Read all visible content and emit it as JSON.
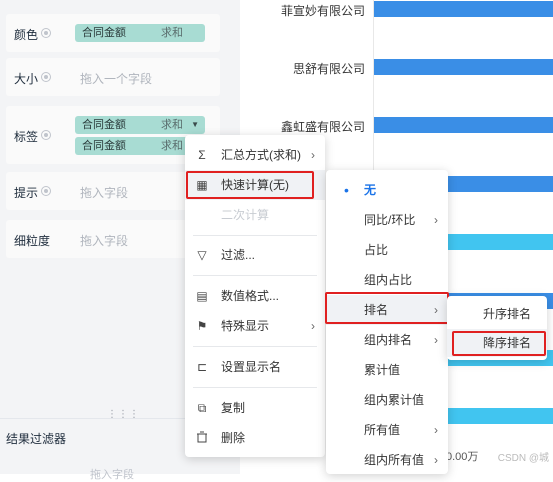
{
  "fields": {
    "color": {
      "label": "颜色",
      "pill_name": "合同金额",
      "pill_agg": "求和"
    },
    "size": {
      "label": "大小",
      "placeholder": "拖入一个字段"
    },
    "tag": {
      "label": "标签",
      "pill1_name": "合同金额",
      "pill1_agg": "求和",
      "pill2_name": "合同金额",
      "pill2_agg": "求和"
    },
    "tooltip": {
      "label": "提示",
      "placeholder": "拖入字段"
    },
    "granularity": {
      "label": "细粒度",
      "placeholder": "拖入字段"
    }
  },
  "result_filter": {
    "title": "结果过滤器",
    "placeholder": "拖入字段"
  },
  "chart": {
    "categories": [
      "菲宣妙有限公司",
      "思舒有限公司",
      "鑫虹盛有限公司"
    ],
    "x_tick": "0.00万",
    "watermark": "CSDN @城"
  },
  "context_menu": {
    "items": [
      {
        "label": "汇总方式(求和)",
        "icon": "sigma-icon",
        "glyph": "Σ"
      },
      {
        "label": "快速计算(无)",
        "icon": "calculator-icon",
        "glyph": "▦"
      },
      {
        "label": "二次计算"
      },
      {
        "label": "过滤...",
        "icon": "filter-icon",
        "glyph": "▽"
      },
      {
        "label": "数值格式...",
        "icon": "number-format-icon",
        "glyph": "▤"
      },
      {
        "label": "特殊显示",
        "icon": "flag-icon",
        "glyph": "⚑"
      },
      {
        "label": "设置显示名",
        "icon": "rename-icon",
        "glyph": "⊏"
      },
      {
        "label": "复制",
        "icon": "copy-icon",
        "glyph": "⧉"
      },
      {
        "label": "删除",
        "icon": "trash-icon",
        "glyph": "🗑"
      }
    ]
  },
  "quick_calc_menu": {
    "items": [
      "无",
      "同比/环比",
      "占比",
      "组内占比",
      "排名",
      "组内排名",
      "累计值",
      "组内累计值",
      "所有值",
      "组内所有值"
    ]
  },
  "rank_menu": {
    "items": [
      "升序排名",
      "降序排名"
    ]
  },
  "colors": {
    "accent": "#1a73e8",
    "highlight_box": "#e02020",
    "bar_blue": "#3a8ee6",
    "bar_cyan": "#41c5f0",
    "pill_bg": "#a8dcd3"
  }
}
